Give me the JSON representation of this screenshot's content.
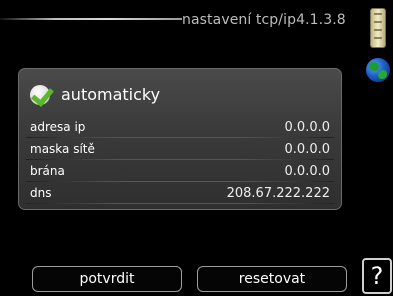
{
  "header": {
    "title": "nastavení tcp/ip4.1.3.8"
  },
  "status_icons": {
    "thermometer": "thermometer-icon",
    "globe": "globe-icon"
  },
  "panel": {
    "mode_label": "automaticky",
    "mode_checked": true,
    "rows": [
      {
        "label": "adresa ip",
        "value": "0.0.0.0"
      },
      {
        "label": "maska sítě",
        "value": "0.0.0.0"
      },
      {
        "label": "brána",
        "value": "0.0.0.0"
      },
      {
        "label": "dns",
        "value": "208.67.222.222"
      }
    ]
  },
  "footer": {
    "confirm_label": "potvrdit",
    "reset_label": "resetovat",
    "help_label": "?"
  },
  "colors": {
    "accent_check": "#5ab82a",
    "background": "#000000"
  }
}
